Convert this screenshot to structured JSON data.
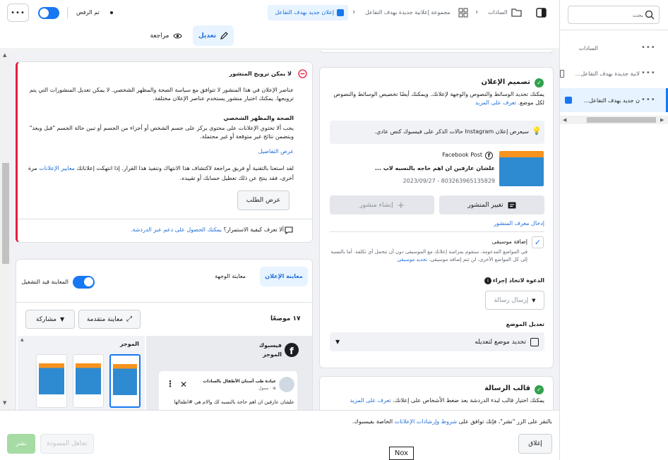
{
  "topbar": {
    "more_label": "•••",
    "rejected_label": "تم الرفض",
    "breadcrumb_account": "السادات",
    "breadcrumb_campaign": "مجموعة إعلانية جديدة بهدف التفاعل",
    "breadcrumb_ad": "إعلان جديد بهدف التفاعل",
    "edit_tab": "تعديل",
    "review_tab": "مراجعة"
  },
  "right_panel": {
    "search_placeholder": "بحث",
    "items": [
      {
        "label": "السادات",
        "more": "•••"
      },
      {
        "label": "...لانية جديدة بهدف التفاعل",
        "more": "•••"
      },
      {
        "label": "...ن جديد بهدف التفاعل",
        "more": "•••"
      }
    ]
  },
  "rejection": {
    "title": "لا يمكن ترويج المنشور",
    "body1": "عناصر الإعلان في هذا المنشور لا تتوافق مع سياسة الصحة والمظهر الشخصي. لا يمكن تعديل المنشورات التي يتم ترويجها. يمكنك اختيار منشور يستخدم عناصر الإعلان مختلفة.",
    "section_title": "الصحة والمظهر الشخصي",
    "section_body": "يجب ألا تحتوي الإعلانات على محتوى يركز على جسم الشخص أو أجزاء من الجسم أو تبين حالة الجسم \"قبل وبعد\" ويتضمن نتائج غير متوقعة أو غير محتملة.",
    "details_link": "عرض التفاصيل",
    "body2_a": "لقد استعنا بالتقنية أو فريق مراجعة لاكتشاف هذا الانتهاك وتنفيذ هذا القرار. إذا انتهكت إعلاناتك ",
    "body2_link": "معايير الإعلانات",
    "body2_b": " مرة أخرى، فقد ينتج عن ذلك تعطيل حسابك أو تقييده.",
    "request_button": "عرض الطلب",
    "help_a": "ألا تعرف كيفية الاستمرار؟ ",
    "help_link": "يمكنك الحصول على دعم عبر الدردشة."
  },
  "preview": {
    "tab_ad_preview": "معاينة الإعلان",
    "tab_page_preview": "معاينة الوجهة",
    "toggle_label": "المعاينة قيد التشغيل",
    "placements_count": "١٧ موضعًا",
    "advanced_preview": "معاينة متقدمة",
    "share": "مشاركة",
    "platform_name": "فيسبوك",
    "platform_sub": "الموجز",
    "feed_label": "الموجز",
    "post_page": "عيادة طب أسنان الأطفال بالسادات",
    "post_meta": "ممول · ⊕",
    "post_text": "علشان عارفين ان اهم حاجة بالنسبه لك والام هي #اطفالها"
  },
  "creative": {
    "title": "تصميم الإعلان",
    "desc": "يمكنك تحديد الوسائط والنصوص والوجهة لإعلانك. ويمكنك أيضًا تخصيص الوسائط والنصوص لكل موضع. ",
    "learn_more": "تعرف على المزيد",
    "instagram_notice": "سيعرض إعلان Instagram حالات الذكر على فيسبوك كنص عادي.",
    "post_source": "Facebook Post",
    "post_title": "علشان عارفين ان اهم حاجه بالنسبه لاب ...",
    "post_id": "2023/09/27 - 803263965135829",
    "change_post": "تغيير المنشور",
    "create_post": "إنشاء منشور",
    "enter_id": "إدخال معرف المنشور",
    "music_title": "إضافة موسيقى",
    "music_desc_a": "في المواضع المدعومة، سنقوم بمزامنة إعلانك مع الموسيقى دون أن تتحمل أي تكلفة. أما بالنسبة إلى كل المواضع الأخرى، لن تتم إضافة موسيقى. ",
    "music_link": "تحديد موسيقى",
    "cta_label": "الدعوة لاتخاذ إجراء",
    "cta_value": "إرسال رسالة",
    "placement_label": "تعديل الموضع",
    "placement_button": "تحديد موضع لتعديله"
  },
  "message_template": {
    "title": "قالب الرسالة",
    "desc": "يمكنك اختيار قالب لبدء الدردشة بعد ضغط الأشخاص على إعلانك. ",
    "learn_more": "تعرف على المزيد"
  },
  "footer": {
    "terms_a": "بالنقر على الزر \"نشر\"، فإنك توافق على ",
    "terms_link": "شروط وإرشادات الإعلانات",
    "terms_b": " الخاصة بفيسبوك.",
    "close": "إغلاق",
    "discard": "تجاهل المسودة",
    "publish": "نشر",
    "tooltip": "Nox"
  },
  "colors": {
    "accent": "#1877f2",
    "error": "#e41e3f",
    "success": "#31a24c"
  }
}
